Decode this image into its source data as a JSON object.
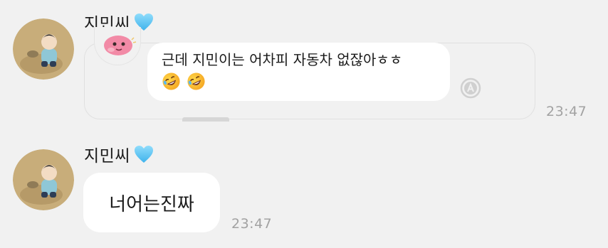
{
  "chat": {
    "messages": [
      {
        "sender": "지민씨",
        "sender_badge": "blue-heart-icon",
        "avatar": "profile-avatar",
        "reply_sticker": "pink-character-sticker",
        "text": "근데 지민이는 어차피 자동차 없잖아ㅎㅎ",
        "emojis": [
          "rolling-on-floor-laughing-emoji",
          "rolling-on-floor-laughing-emoji"
        ],
        "time": "23:47",
        "reaction_button": "reaction-icon"
      },
      {
        "sender": "지민씨",
        "sender_badge": "blue-heart-icon",
        "avatar": "profile-avatar",
        "text": "너어는진짜",
        "time": "23:47"
      }
    ]
  },
  "colors": {
    "background": "#f1f1f1",
    "bubble": "#ffffff",
    "heart": "#5bc6f5",
    "time": "#a2a2a2"
  }
}
